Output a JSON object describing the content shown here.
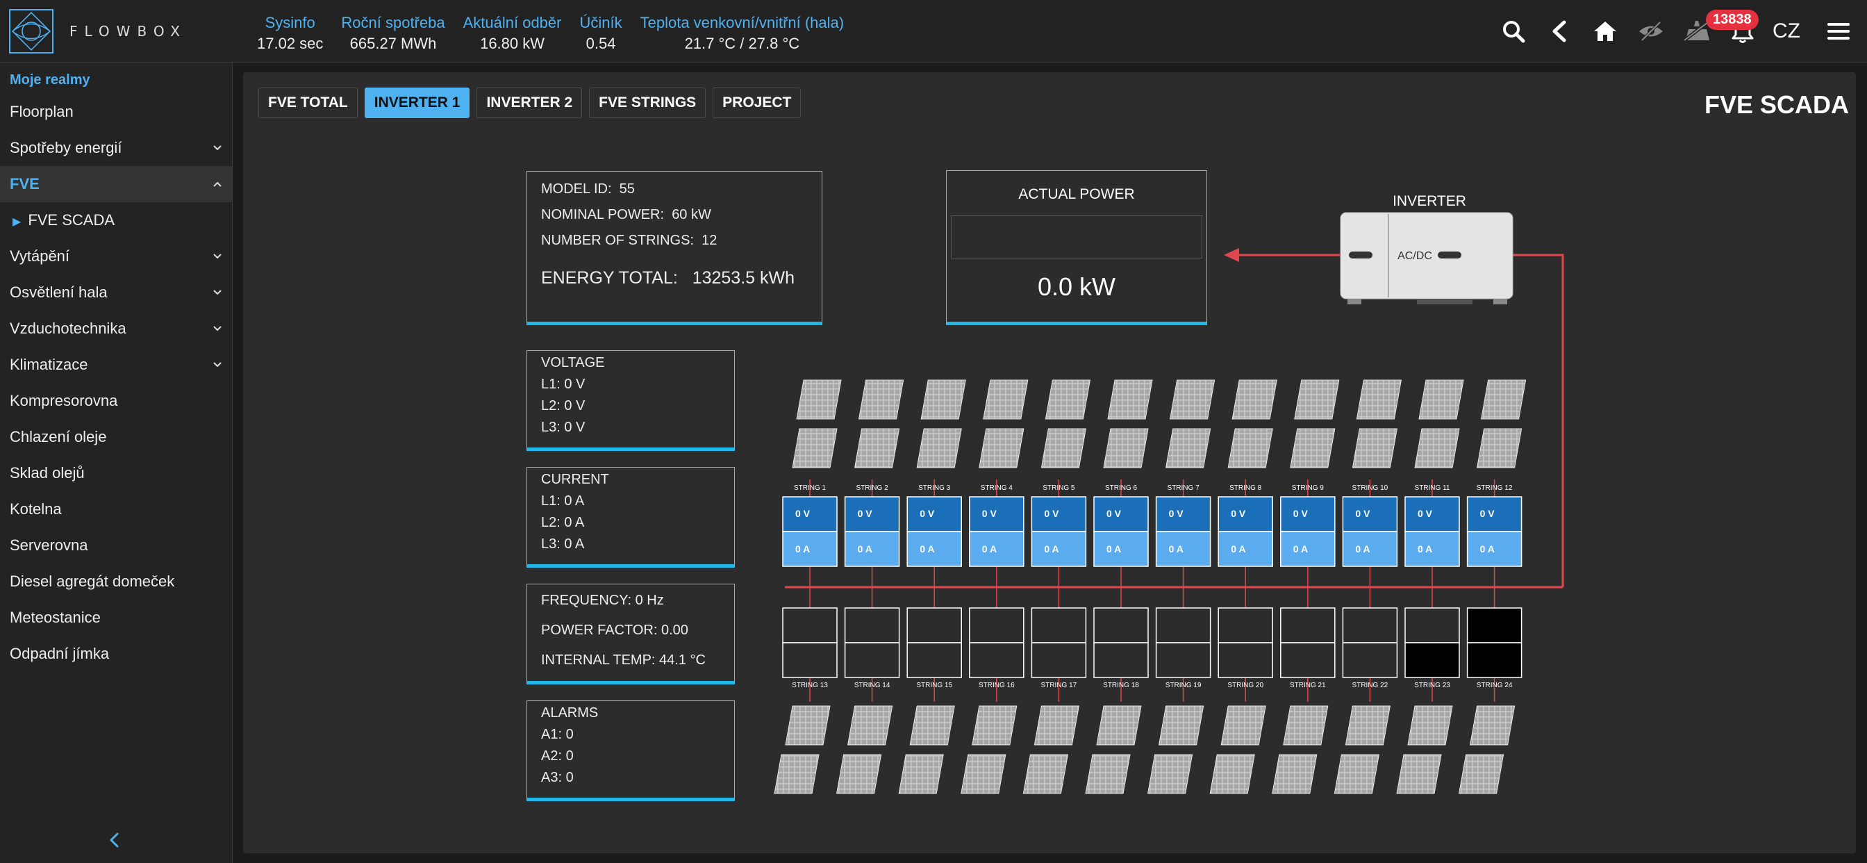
{
  "header": {
    "logo_text": "FLOWBOX",
    "kpis": [
      {
        "label": "Sysinfo",
        "value": "17.02 sec"
      },
      {
        "label": "Roční spotřeba",
        "value": "665.27 MWh"
      },
      {
        "label": "Aktuální odběr",
        "value": "16.80 kW"
      },
      {
        "label": "Účiník",
        "value": "0.54"
      },
      {
        "label": "Teplota venkovní/vnitřní (hala)",
        "value": "21.7 °C / 27.8 °C"
      }
    ],
    "notifications": "13838",
    "language": "CZ"
  },
  "sidebar": {
    "heading": "Moje realmy",
    "items": [
      {
        "label": "Floorplan"
      },
      {
        "label": "Spotřeby energií"
      },
      {
        "label": "FVE"
      },
      {
        "label": "FVE SCADA"
      },
      {
        "label": "Vytápění"
      },
      {
        "label": "Osvětlení hala"
      },
      {
        "label": "Vzduchotechnika"
      },
      {
        "label": "Klimatizace"
      },
      {
        "label": "Kompresorovna"
      },
      {
        "label": "Chlazení oleje"
      },
      {
        "label": "Sklad olejů"
      },
      {
        "label": "Kotelna"
      },
      {
        "label": "Serverovna"
      },
      {
        "label": "Diesel agregát domeček"
      },
      {
        "label": "Meteostanice"
      },
      {
        "label": "Odpadní jímka"
      }
    ]
  },
  "tabs": [
    {
      "label": "FVE TOTAL"
    },
    {
      "label": "INVERTER 1"
    },
    {
      "label": "INVERTER 2"
    },
    {
      "label": "FVE STRINGS"
    },
    {
      "label": "PROJECT"
    }
  ],
  "page_title": "FVE SCADA",
  "info": {
    "model_label": "MODEL ID:",
    "model_value": "55",
    "nominal_label": "NOMINAL POWER:",
    "nominal_value": "60 kW",
    "strings_label": "NUMBER OF STRINGS:",
    "strings_value": "12",
    "energy_label": "ENERGY TOTAL:",
    "energy_value": "13253.5 kWh"
  },
  "actual_power": {
    "title": "ACTUAL POWER",
    "value": "0.0 kW"
  },
  "inverter": {
    "title": "INVERTER",
    "device_label": "AC/DC"
  },
  "voltage": {
    "title": "VOLTAGE",
    "l1": "L1:  0 V",
    "l2": "L2:  0 V",
    "l3": "L3:  0 V"
  },
  "current": {
    "title": "CURRENT",
    "l1": "L1:  0 A",
    "l2": "L2:  0 A",
    "l3": "L3:  0 A"
  },
  "misc": {
    "frequency": "FREQUENCY:  0 Hz",
    "power_factor": "POWER FACTOR:  0.00",
    "internal_temp": "INTERNAL TEMP:  44.1 °C"
  },
  "alarms": {
    "title": "ALARMS",
    "a1": "A1:  0",
    "a2": "A2:  0",
    "a3": "A3:  0"
  },
  "strings_top": [
    {
      "label": "STRING 1",
      "v": "0 V",
      "a": "0 A"
    },
    {
      "label": "STRING 2",
      "v": "0 V",
      "a": "0 A"
    },
    {
      "label": "STRING 3",
      "v": "0 V",
      "a": "0 A"
    },
    {
      "label": "STRING 4",
      "v": "0 V",
      "a": "0 A"
    },
    {
      "label": "STRING 5",
      "v": "0 V",
      "a": "0 A"
    },
    {
      "label": "STRING 6",
      "v": "0 V",
      "a": "0 A"
    },
    {
      "label": "STRING 7",
      "v": "0 V",
      "a": "0 A"
    },
    {
      "label": "STRING 8",
      "v": "0 V",
      "a": "0 A"
    },
    {
      "label": "STRING 9",
      "v": "0 V",
      "a": "0 A"
    },
    {
      "label": "STRING 10",
      "v": "0 V",
      "a": "0 A"
    },
    {
      "label": "STRING 11",
      "v": "0 V",
      "a": "0 A"
    },
    {
      "label": "STRING 12",
      "v": "0 V",
      "a": "0 A"
    }
  ],
  "strings_bottom": [
    {
      "label": "STRING 13"
    },
    {
      "label": "STRING 14"
    },
    {
      "label": "STRING 15"
    },
    {
      "label": "STRING 16"
    },
    {
      "label": "STRING 17"
    },
    {
      "label": "STRING 18"
    },
    {
      "label": "STRING 19"
    },
    {
      "label": "STRING 20"
    },
    {
      "label": "STRING 21"
    },
    {
      "label": "STRING 22"
    },
    {
      "label": "STRING 23"
    },
    {
      "label": "STRING 24"
    }
  ],
  "colors": {
    "accent": "#4fb1f0",
    "box_underline": "#1fb7e8",
    "string_dark": "#1a6fb8",
    "string_light": "#5aacef",
    "wire": "#e0474f",
    "badge": "#e5303f"
  }
}
